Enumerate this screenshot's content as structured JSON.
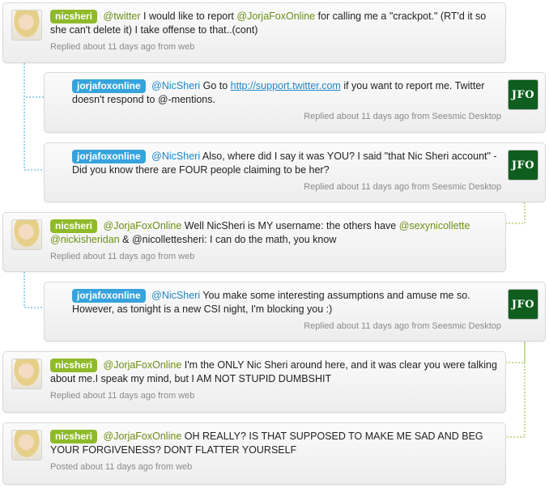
{
  "conversation": {
    "tweets": [
      {
        "author": "nicsheri",
        "mention": "@twitter",
        "text_before": "I would like to report",
        "mention2": "@JorjaFoxOnline",
        "text_after": "for calling me a \"crackpot.\" (RT'd it so she can't delete it) I take offense to that..(cont)",
        "meta": "Replied about 11 days ago from web"
      },
      {
        "author": "jorjafoxonline",
        "mention": "@NicSheri",
        "text_before": "Go to",
        "link": "http://support.twitter.com",
        "text_after": "if you want to report me. Twitter doesn't respond to @-mentions.",
        "meta": "Replied about 11 days ago from Seesmic Desktop",
        "avatar_text": "JFO"
      },
      {
        "author": "jorjafoxonline",
        "mention": "@NicSheri",
        "text": "Also, where did I say it was YOU? I said \"that Nic Sheri account\" - Did you know there are FOUR people claiming to be her?",
        "meta": "Replied about 11 days ago from Seesmic Desktop",
        "avatar_text": "JFO"
      },
      {
        "author": "nicsheri",
        "mention": "@JorjaFoxOnline",
        "text_before": "Well NicSheri is MY username: the others have",
        "mention2": "@sexynicollette",
        "mention3": "@nickisheridan",
        "text_mid": "& @nicollettesheri: I can do the math, you know",
        "meta": "Replied about 11 days ago from web"
      },
      {
        "author": "jorjafoxonline",
        "mention": "@NicSheri",
        "text": "You make some interesting assumptions and amuse me so. However, as tonight is a new CSI night, I'm blocking you :)",
        "meta": "Replied about 11 days ago from Seesmic Desktop",
        "avatar_text": "JFO"
      },
      {
        "author": "nicsheri",
        "mention": "@JorjaFoxOnline",
        "text": "I'm the ONLY Nic Sheri around here, and it was clear you were talking about me.I speak my mind, but I AM NOT STUPID DUMBSHIT",
        "meta": "Replied about 11 days ago from web"
      },
      {
        "author": "nicsheri",
        "mention": "@JorjaFoxOnline",
        "text": "OH REALLY? IS THAT SUPPOSED TO MAKE ME SAD AND BEG YOUR FORGIVENESS? DONT FLATTER YOURSELF",
        "meta": "Posted about 11 days ago from web"
      }
    ]
  },
  "colors": {
    "green_tag": "#8fba2a",
    "blue_tag": "#36a3dd",
    "connector_blue": "#36a3dd",
    "connector_green": "#8fba2a"
  },
  "icons": {
    "user_avatar": "avatar-photo",
    "jfo_avatar": "jfo-logo"
  }
}
